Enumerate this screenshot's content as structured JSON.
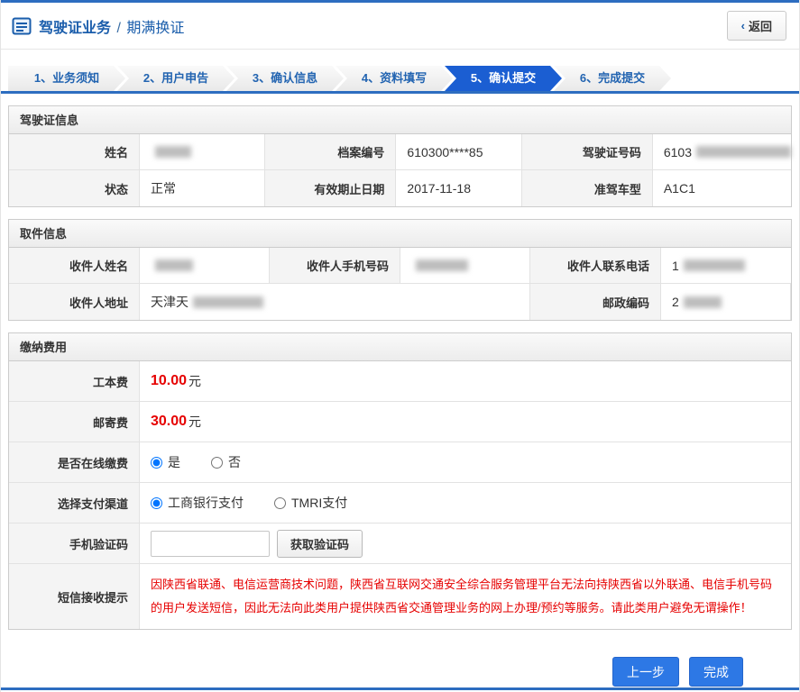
{
  "colors": {
    "accent": "#2d6dc0",
    "active_step": "#1b5ed2",
    "button_blue": "#2d78e5",
    "alert_red": "#e60000",
    "title_blue": "#1a5dab"
  },
  "header": {
    "business_title": "驾驶证业务",
    "separator": "/",
    "page_title": "期满换证",
    "back_chevron": "‹",
    "back_label": "返回"
  },
  "steps": [
    {
      "label": "1、业务须知"
    },
    {
      "label": "2、用户申告"
    },
    {
      "label": "3、确认信息"
    },
    {
      "label": "4、资料填写"
    },
    {
      "label": "5、确认提交"
    },
    {
      "label": "6、完成提交"
    }
  ],
  "active_step": "5、确认提交",
  "license": {
    "title": "驾驶证信息",
    "name_label": "姓名",
    "file_label": "档案编号",
    "file_value": "610300****85",
    "license_no_label": "驾驶证号码",
    "license_no_prefix": "6103",
    "status_label": "状态",
    "status_value": "正常",
    "expiry_label": "有效期止日期",
    "expiry_value": "2017-11-18",
    "vehicle_label": "准驾车型",
    "vehicle_value": "A1C1"
  },
  "pickup": {
    "title": "取件信息",
    "recipient_name_label": "收件人姓名",
    "mobile_label": "收件人手机号码",
    "phone_label": "收件人联系电话",
    "phone_prefix": "1",
    "address_label": "收件人地址",
    "address_prefix": "天津天",
    "postal_label": "邮政编码",
    "postal_prefix": "2"
  },
  "payment": {
    "title": "缴纳费用",
    "production_fee_label": "工本费",
    "production_fee_amount": "10.00",
    "production_fee_unit": "元",
    "mailing_fee_label": "邮寄费",
    "mailing_fee_amount": "30.00",
    "mailing_fee_unit": "元",
    "online_label": "是否在线缴费",
    "online_yes": "是",
    "online_no": "否",
    "online_selected": "是",
    "channel_label": "选择支付渠道",
    "channel_icbc": "工商银行支付",
    "channel_tmri": "TMRI支付",
    "channel_selected": "工商银行支付",
    "captcha_label": "手机验证码",
    "captcha_value": "",
    "captcha_button": "获取验证码",
    "notice_label": "短信接收提示",
    "notice_text": "因陕西省联通、电信运营商技术问题，陕西省互联网交通安全综合服务管理平台无法向持陕西省以外联通、电信手机号码的用户发送短信，因此无法向此类用户提供陕西省交通管理业务的网上办理/预约等服务。请此类用户避免无谓操作！"
  },
  "footer": {
    "prev_button": "上一步",
    "finish_button": "完成"
  }
}
